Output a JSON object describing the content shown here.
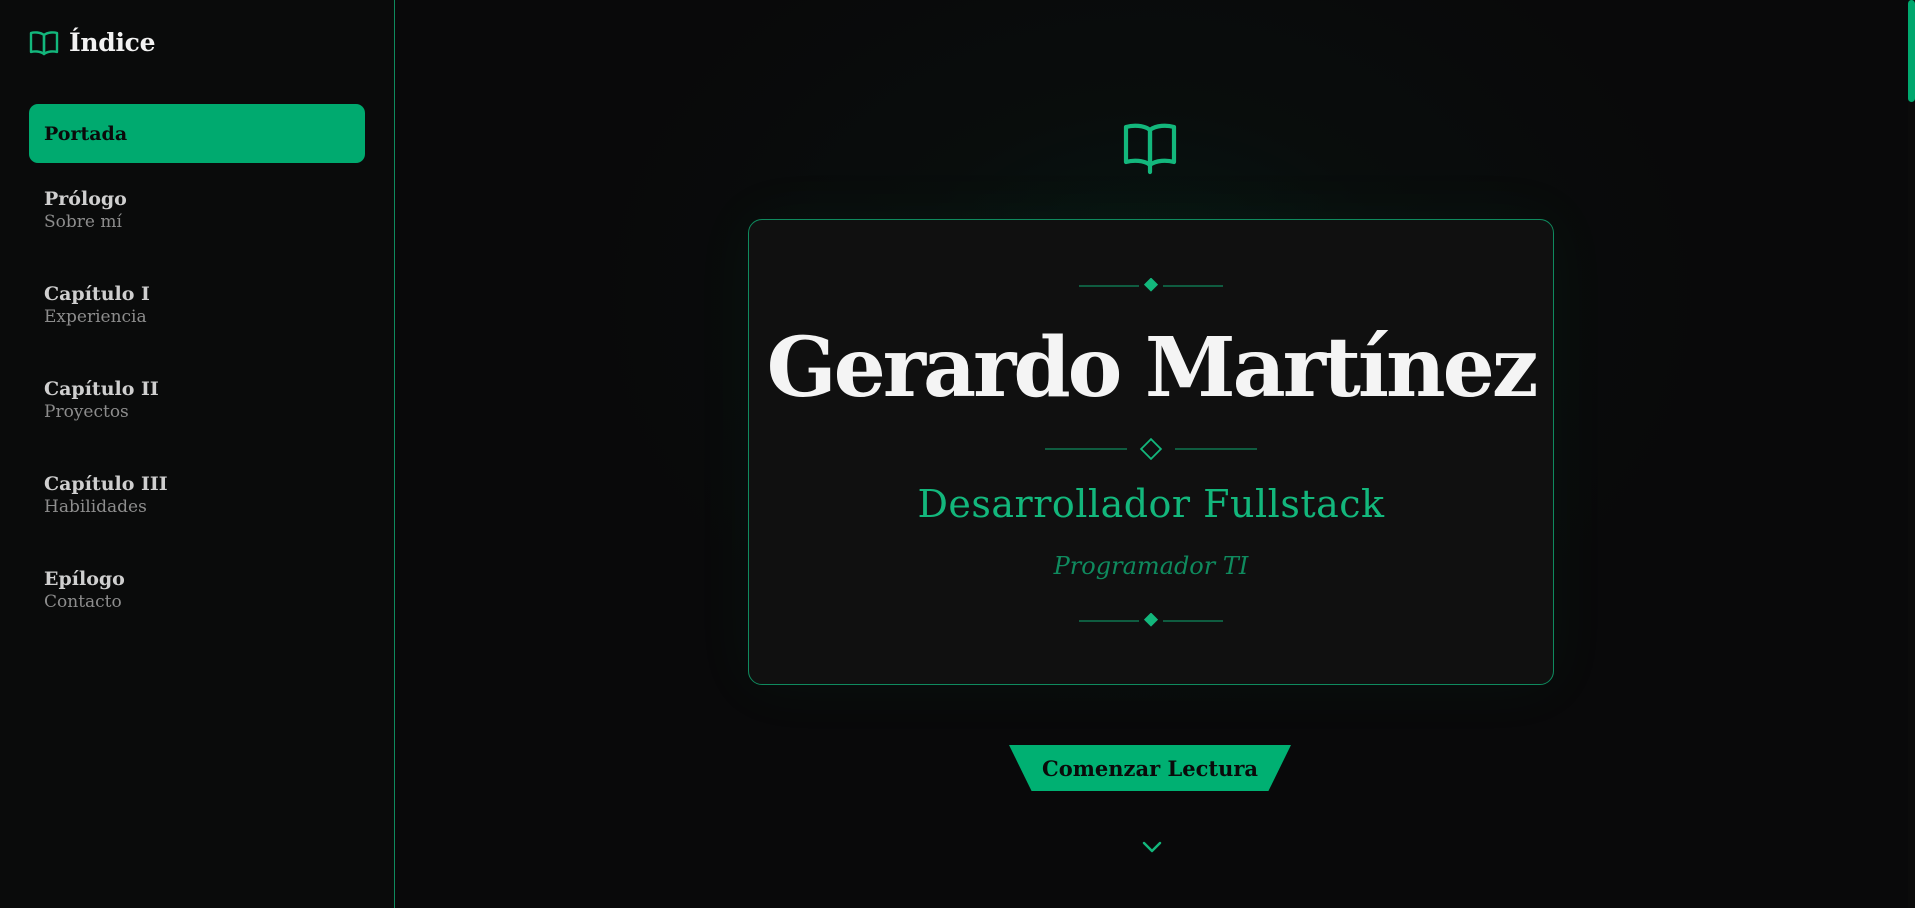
{
  "sidebar": {
    "title": "Índice",
    "icon": "book-open-icon",
    "items": [
      {
        "label": "Portada",
        "sub": "",
        "active": true
      },
      {
        "label": "Prólogo",
        "sub": "Sobre mí"
      },
      {
        "label": "Capítulo I",
        "sub": "Experiencia"
      },
      {
        "label": "Capítulo II",
        "sub": "Proyectos"
      },
      {
        "label": "Capítulo III",
        "sub": "Habilidades"
      },
      {
        "label": "Epílogo",
        "sub": "Contacto"
      }
    ]
  },
  "cover": {
    "icon": "book-open-icon",
    "name": "Gerardo Martínez",
    "role": "Desarrollador Fullstack",
    "subrole": "Programador TI",
    "cta_label": "Comenzar Lectura",
    "scroll_icon": "chevron-down-icon"
  },
  "colors": {
    "accent": "#00aa6f",
    "background": "#09090a",
    "card": "#101010",
    "text": "#f4f4f4"
  }
}
